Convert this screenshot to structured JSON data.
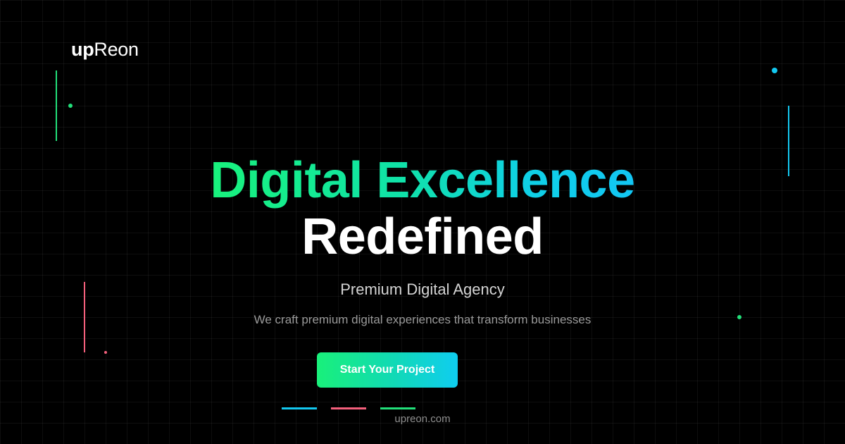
{
  "brand": {
    "logo_bold": "up",
    "logo_light": "Reon"
  },
  "hero": {
    "headline_gradient": "Digital Excellence",
    "headline_white": "Redefined",
    "subtitle": "Premium Digital Agency",
    "tagline": "We craft premium digital experiences that transform businesses",
    "cta_label": "Start Your Project"
  },
  "footer": {
    "url": "upreon.com"
  },
  "colors": {
    "background": "#000000",
    "accent_green": "#22e07a",
    "accent_blue": "#13c8f0",
    "accent_pink": "#f4607c",
    "text_primary": "#ffffff",
    "text_secondary": "#d4d4d4",
    "text_muted": "#9a9a9a"
  }
}
